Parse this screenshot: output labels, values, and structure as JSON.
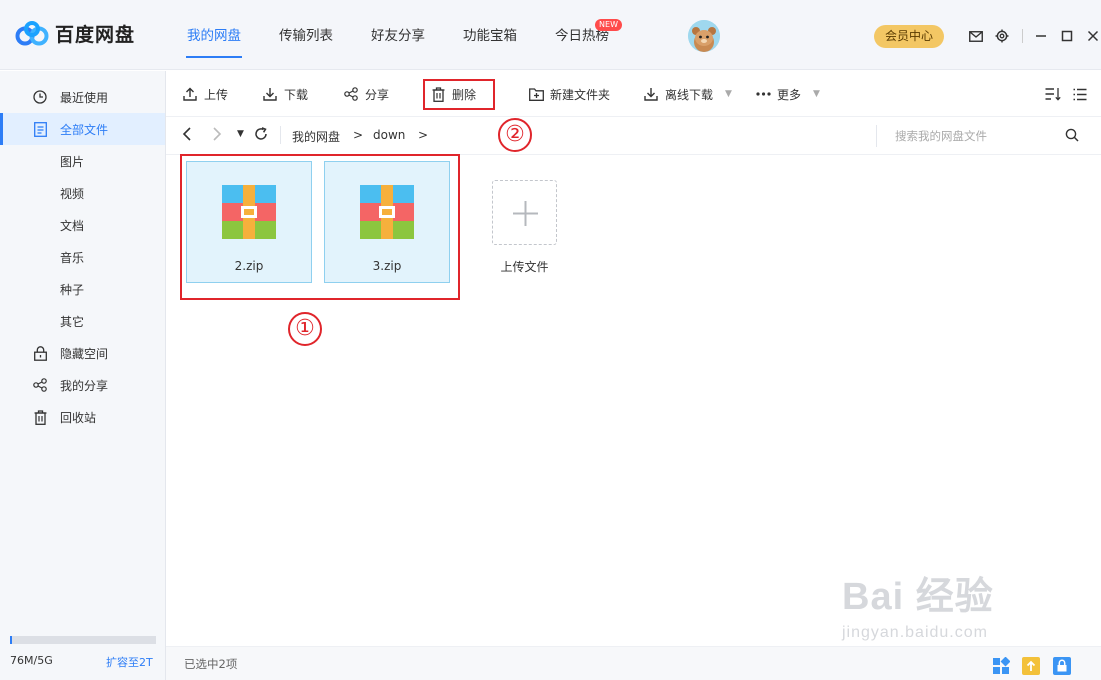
{
  "app": {
    "name": "百度网盘",
    "vip_label": "会员中心"
  },
  "nav": [
    {
      "label": "我的网盘",
      "active": true
    },
    {
      "label": "传输列表",
      "active": false
    },
    {
      "label": "好友分享",
      "active": false
    },
    {
      "label": "功能宝箱",
      "active": false
    },
    {
      "label": "今日热榜",
      "active": false,
      "badge": "NEW"
    }
  ],
  "sidebar": {
    "items": [
      {
        "label": "最近使用",
        "icon": "clock-icon",
        "sub": false,
        "active": false
      },
      {
        "label": "全部文件",
        "icon": "document-icon",
        "sub": false,
        "active": true
      },
      {
        "label": "图片",
        "sub": true,
        "active": false
      },
      {
        "label": "视频",
        "sub": true,
        "active": false
      },
      {
        "label": "文档",
        "sub": true,
        "active": false
      },
      {
        "label": "音乐",
        "sub": true,
        "active": false
      },
      {
        "label": "种子",
        "sub": true,
        "active": false
      },
      {
        "label": "其它",
        "sub": true,
        "active": false
      },
      {
        "label": "隐藏空间",
        "icon": "lock-icon",
        "sub": false,
        "active": false
      },
      {
        "label": "我的分享",
        "icon": "share-icon",
        "sub": false,
        "active": false
      },
      {
        "label": "回收站",
        "icon": "trash-icon",
        "sub": false,
        "active": false
      }
    ],
    "storage_used": "76M/5G",
    "storage_fraction": 0.015,
    "expand_label": "扩容至2T"
  },
  "toolbar": {
    "upload": "上传",
    "download": "下载",
    "share": "分享",
    "delete": "删除",
    "new_folder": "新建文件夹",
    "offline_download": "离线下载",
    "more": "更多"
  },
  "breadcrumb": {
    "root": "我的网盘",
    "sep1": ">",
    "current": "down",
    "sep2": ">"
  },
  "search": {
    "placeholder": "搜索我的网盘文件"
  },
  "files": [
    {
      "name": "2.zip",
      "selected": true
    },
    {
      "name": "3.zip",
      "selected": true
    }
  ],
  "upload_tile_label": "上传文件",
  "annotations": {
    "step1": "①",
    "step2": "②"
  },
  "status": {
    "selection": "已选中2项"
  },
  "watermark": {
    "big": "Bai 经验",
    "small": "jingyan.baidu.com"
  },
  "colors": {
    "accent": "#2d7df6",
    "highlight": "#e0252b",
    "vip": "#f3c764"
  }
}
